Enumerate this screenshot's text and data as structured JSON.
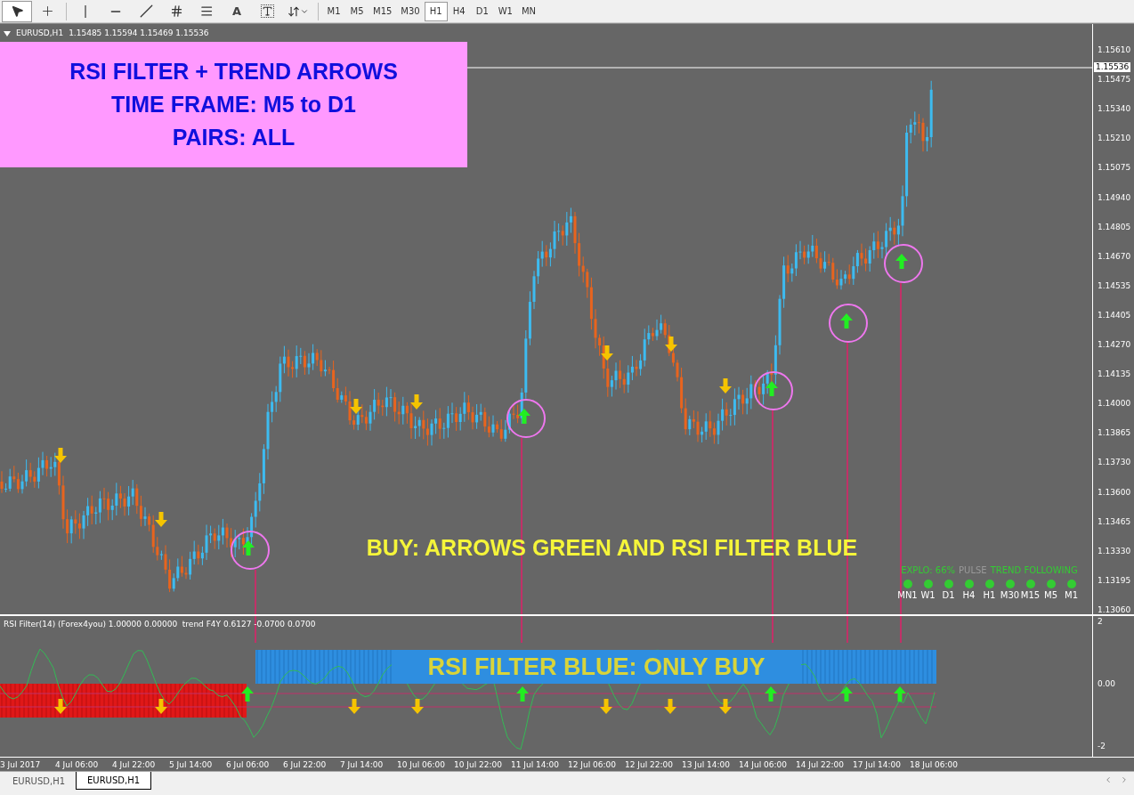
{
  "toolbar": {
    "text_tool": "A",
    "timeframes": [
      {
        "label": "M1",
        "selected": false
      },
      {
        "label": "M5",
        "selected": false
      },
      {
        "label": "M15",
        "selected": false
      },
      {
        "label": "M30",
        "selected": false
      },
      {
        "label": "H1",
        "selected": true
      },
      {
        "label": "H4",
        "selected": false
      },
      {
        "label": "D1",
        "selected": false
      },
      {
        "label": "W1",
        "selected": false
      },
      {
        "label": "MN",
        "selected": false
      }
    ]
  },
  "chart": {
    "symbol": "EURUSD,H1",
    "ohlc": "1.15485 1.15594 1.15469 1.15536",
    "banner": [
      "RSI FILTER + TREND ARROWS",
      "TIME FRAME: M5 to D1",
      "PAIRS: ALL"
    ],
    "buy_note": "BUY: ARROWS GREEN AND RSI FILTER BLUE",
    "dashboard": {
      "explo": "EXPLO: 66%",
      "pulse": "PULSE",
      "trend": "TREND FOLLOWING",
      "timeframes": [
        {
          "label": "MN1",
          "color": "#33cc33"
        },
        {
          "label": "W1",
          "color": "#33cc33"
        },
        {
          "label": "D1",
          "color": "#33cc33"
        },
        {
          "label": "H4",
          "color": "#33cc33"
        },
        {
          "label": "H1",
          "color": "#33cc33"
        },
        {
          "label": "M30",
          "color": "#33cc33"
        },
        {
          "label": "M15",
          "color": "#33cc33"
        },
        {
          "label": "M5",
          "color": "#33cc33"
        },
        {
          "label": "M1",
          "color": "#33cc33"
        }
      ]
    },
    "current_price": "1.15536",
    "price_axis": [
      "1.15610",
      "1.15475",
      "1.15340",
      "1.15210",
      "1.15075",
      "1.14940",
      "1.14805",
      "1.14670",
      "1.14535",
      "1.14405",
      "1.14270",
      "1.14135",
      "1.14000",
      "1.13865",
      "1.13730",
      "1.13600",
      "1.13465",
      "1.13330",
      "1.13195",
      "1.13060"
    ]
  },
  "indicator": {
    "legend": "RSI Filter(14) (Forex4you) 1.00000 0.00000  trend F4Y 0.6127 -0.0700 0.0700",
    "note": "RSI FILTER BLUE: ONLY BUY",
    "axis": [
      "2",
      "0.00",
      "-2"
    ]
  },
  "time_axis": [
    "3 Jul 2017",
    "4 Jul 06:00",
    "4 Jul 22:00",
    "5 Jul 14:00",
    "6 Jul 06:00",
    "6 Jul 22:00",
    "7 Jul 14:00",
    "10 Jul 06:00",
    "10 Jul 22:00",
    "11 Jul 14:00",
    "12 Jul 06:00",
    "12 Jul 22:00",
    "13 Jul 14:00",
    "14 Jul 06:00",
    "14 Jul 22:00",
    "17 Jul 14:00",
    "18 Jul 06:00"
  ],
  "tabs": [
    {
      "label": "EURUSD,H1",
      "selected": false
    },
    {
      "label": "EURUSD,H1",
      "selected": true
    }
  ]
}
